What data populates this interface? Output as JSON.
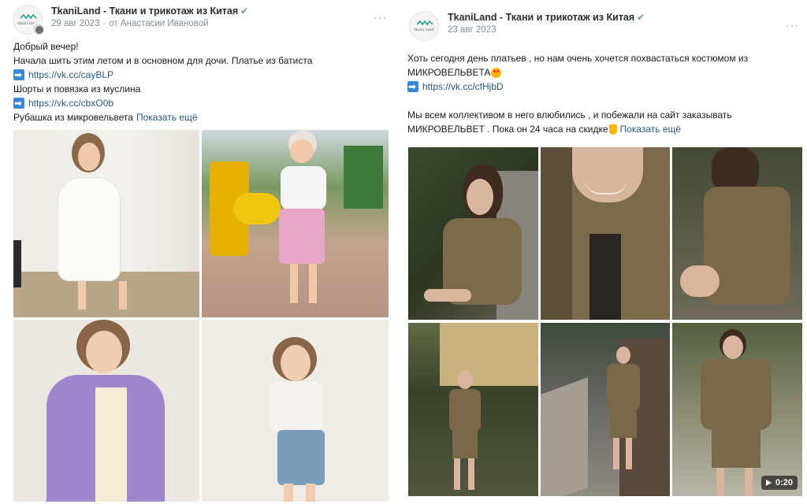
{
  "left_post": {
    "author": "TkaniLand - Ткани и трикотаж из Китая",
    "avatar_text": "tkani land",
    "date": "29 авг 2023",
    "meta_sep": "·",
    "by": "от Анастасии Ивановой",
    "more": "···",
    "lines": {
      "l1": "Добрый вечер!",
      "l2": "Начала шить этим летом и в основном для дочи. Платье из батиста",
      "link1": "https://vk.cc/cayBLP",
      "l3": "Шорты и повязка из муслина",
      "link2": "https://vk.cc/cbxO0b",
      "l4": "Рубашка из микровельвета",
      "show_more": "Показать ещё"
    },
    "photos": [
      "girl-white-dress",
      "girl-playground",
      "girl-lilac-shirt",
      "girl-blue-shorts"
    ]
  },
  "right_post": {
    "author": "TkaniLand - Ткани и трикотаж из Китая",
    "avatar_text": "tkani land",
    "date": "23 авг 2023",
    "more": "···",
    "lines": {
      "l1": "Хоть сегодня день платьев , но нам очень хочется похвастаться костюмом из",
      "l2": "МИКРОВЕЛЬВЕТА",
      "link1": "https://vk.cc/cfHjbD",
      "l3": "Мы всем коллективом в него влюбились , и побежали на сайт заказывать",
      "l4": "МИКРОВЕЛЬВЕТ . Пока он 24 часа на скидке",
      "show_more": "Показать ещё"
    },
    "photos": [
      "woman-sitting-wall",
      "jacket-closeup",
      "woman-sitting-side",
      "woman-full-house",
      "woman-stairs",
      "woman-walking-video"
    ],
    "video_duration": "0:20"
  },
  "colors": {
    "link": "#2a5885",
    "meta": "#818c99",
    "verified": "#6b8fb8",
    "arrow": "#3a87d6"
  }
}
